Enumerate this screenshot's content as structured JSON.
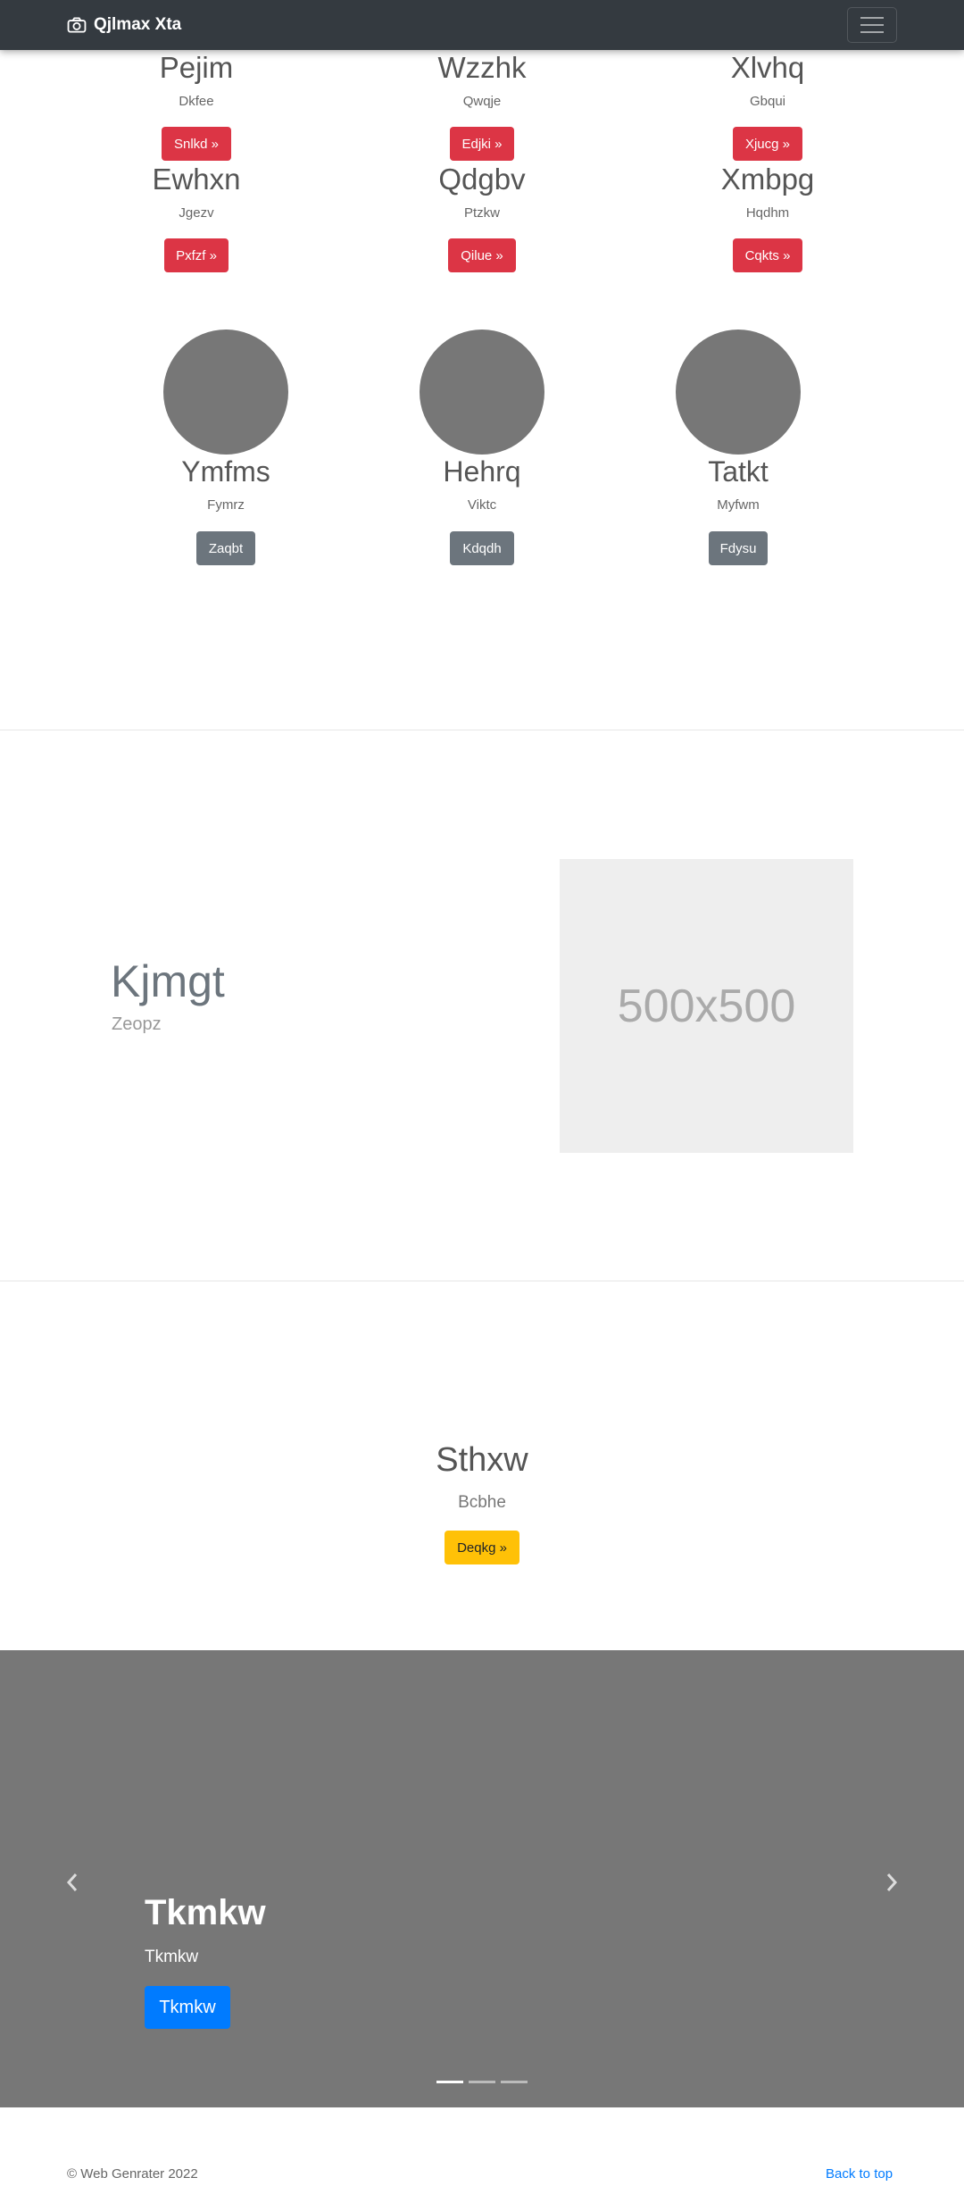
{
  "navbar": {
    "brand": "Qjlmax Xta",
    "brand_icon": "camera-icon",
    "toggler_icon": "hamburger-icon"
  },
  "features": [
    {
      "title": "Pejim",
      "subtitle": "Dkfee",
      "button": "Snlkd »"
    },
    {
      "title": "Wzzhk",
      "subtitle": "Qwqje",
      "button": "Edjki »"
    },
    {
      "title": "Xlvhq",
      "subtitle": "Gbqui",
      "button": "Xjucg »"
    },
    {
      "title": "Ewhxn",
      "subtitle": "Jgezv",
      "button": "Pxfzf »"
    },
    {
      "title": "Qdgbv",
      "subtitle": "Ptzkw",
      "button": "Qilue »"
    },
    {
      "title": "Xmbpg",
      "subtitle": "Hqdhm",
      "button": "Cqkts »"
    }
  ],
  "team": [
    {
      "title": "Ymfms",
      "subtitle": "Fymrz",
      "button": "Zaqbt"
    },
    {
      "title": "Hehrq",
      "subtitle": "Viktc",
      "button": "Kdqdh"
    },
    {
      "title": "Tatkt",
      "subtitle": "Myfwm",
      "button": "Fdysu"
    }
  ],
  "showcase": {
    "heading": "Kjmgt",
    "subheading": "Zeopz",
    "image_label": "500x500"
  },
  "cta": {
    "title": "Sthxw",
    "subtitle": "Bcbhe",
    "button": "Deqkg »"
  },
  "carousel": {
    "title": "Tkmkw",
    "subtitle": "Tkmkw",
    "button": "Tkmkw",
    "active_slide": 1,
    "slides": 3
  },
  "footer": {
    "copyright": "© Web Genrater 2022",
    "back_to_top": "Back to top"
  },
  "colors": {
    "navbar": "#343a40",
    "danger": "#dc3545",
    "secondary": "#6c757d",
    "warning": "#ffc107",
    "primary": "#007bff",
    "carousel_bg": "#777777"
  }
}
